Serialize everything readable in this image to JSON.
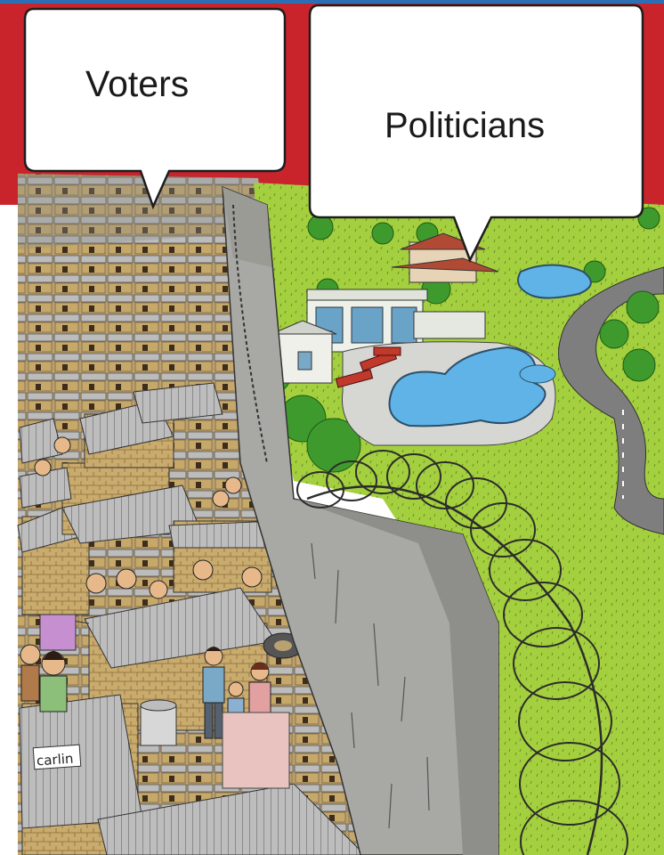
{
  "speech_bubbles": {
    "left_label": "Voters",
    "right_label": "Politicians"
  },
  "signature": "carlin",
  "colors": {
    "sky": "#c9242c",
    "grass": "#9ccc3c",
    "pool_water": "#5fb3e6",
    "wall": "#a8a8a4",
    "slum_roof": "#b7b7b7",
    "slum_wall": "#c9ab6e",
    "road": "#7e7e7e"
  }
}
